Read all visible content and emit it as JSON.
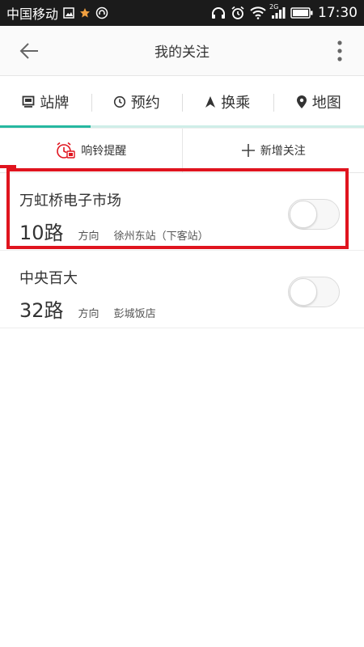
{
  "status_bar": {
    "carrier": "中国移动",
    "network": "2G",
    "time": "17:30"
  },
  "header": {
    "title": "我的关注"
  },
  "tabs": [
    {
      "label": "站牌",
      "icon": "bus-stop-icon",
      "active": true
    },
    {
      "label": "预约",
      "icon": "clock-icon",
      "active": false
    },
    {
      "label": "换乘",
      "icon": "navigation-arrow-icon",
      "active": false
    },
    {
      "label": "地图",
      "icon": "map-pin-icon",
      "active": false
    }
  ],
  "actions": {
    "ring_reminder": "响铃提醒",
    "add_follow": "新增关注"
  },
  "items": [
    {
      "station": "万虹桥电子市场",
      "route": "10路",
      "direction_label": "方向",
      "direction": "徐州东站（下客站）",
      "enabled": false
    },
    {
      "station": "中央百大",
      "route": "32路",
      "direction_label": "方向",
      "direction": "彭城饭店",
      "enabled": false
    }
  ],
  "colors": {
    "accent": "#26b8a0",
    "highlight": "#e0141e",
    "alarm": "#e0141e"
  }
}
